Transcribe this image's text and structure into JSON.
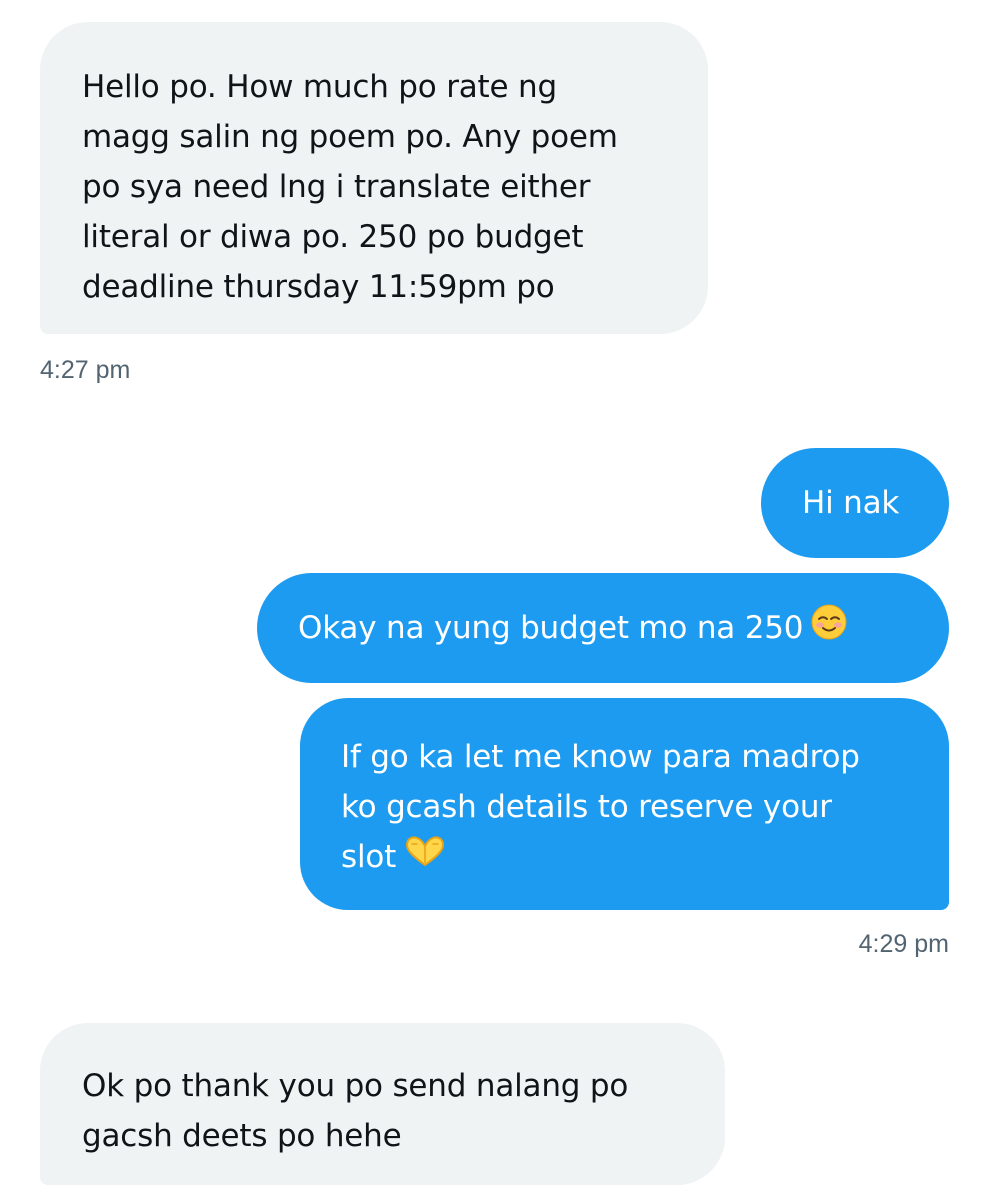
{
  "conversation": {
    "messages": [
      {
        "sender": "other",
        "lines": [
          "Hello po. How much po rate ng",
          "magg salin ng poem po. Any poem",
          "po sya need lng i translate either",
          "literal or diwa po. 250 po budget",
          "deadline thursday 11:59pm po"
        ],
        "time": "4:27 pm"
      },
      {
        "sender": "me",
        "text": "Hi nak"
      },
      {
        "sender": "me",
        "text": "Okay na yung budget mo na 250",
        "emoji": "smiling-face-emoji"
      },
      {
        "sender": "me",
        "lines": [
          "If go ka let me know para madrop",
          "ko gcash details to reserve your",
          "slot"
        ],
        "emoji": "heart-hands-emoji",
        "time": "4:29 pm"
      },
      {
        "sender": "other",
        "lines": [
          "Ok po thank you po send nalang po",
          "gacsh deets po hehe"
        ]
      }
    ]
  },
  "colors": {
    "incoming_bubble": "#eff3f4",
    "outgoing_bubble": "#1d9bf0",
    "timestamp": "#536471"
  }
}
